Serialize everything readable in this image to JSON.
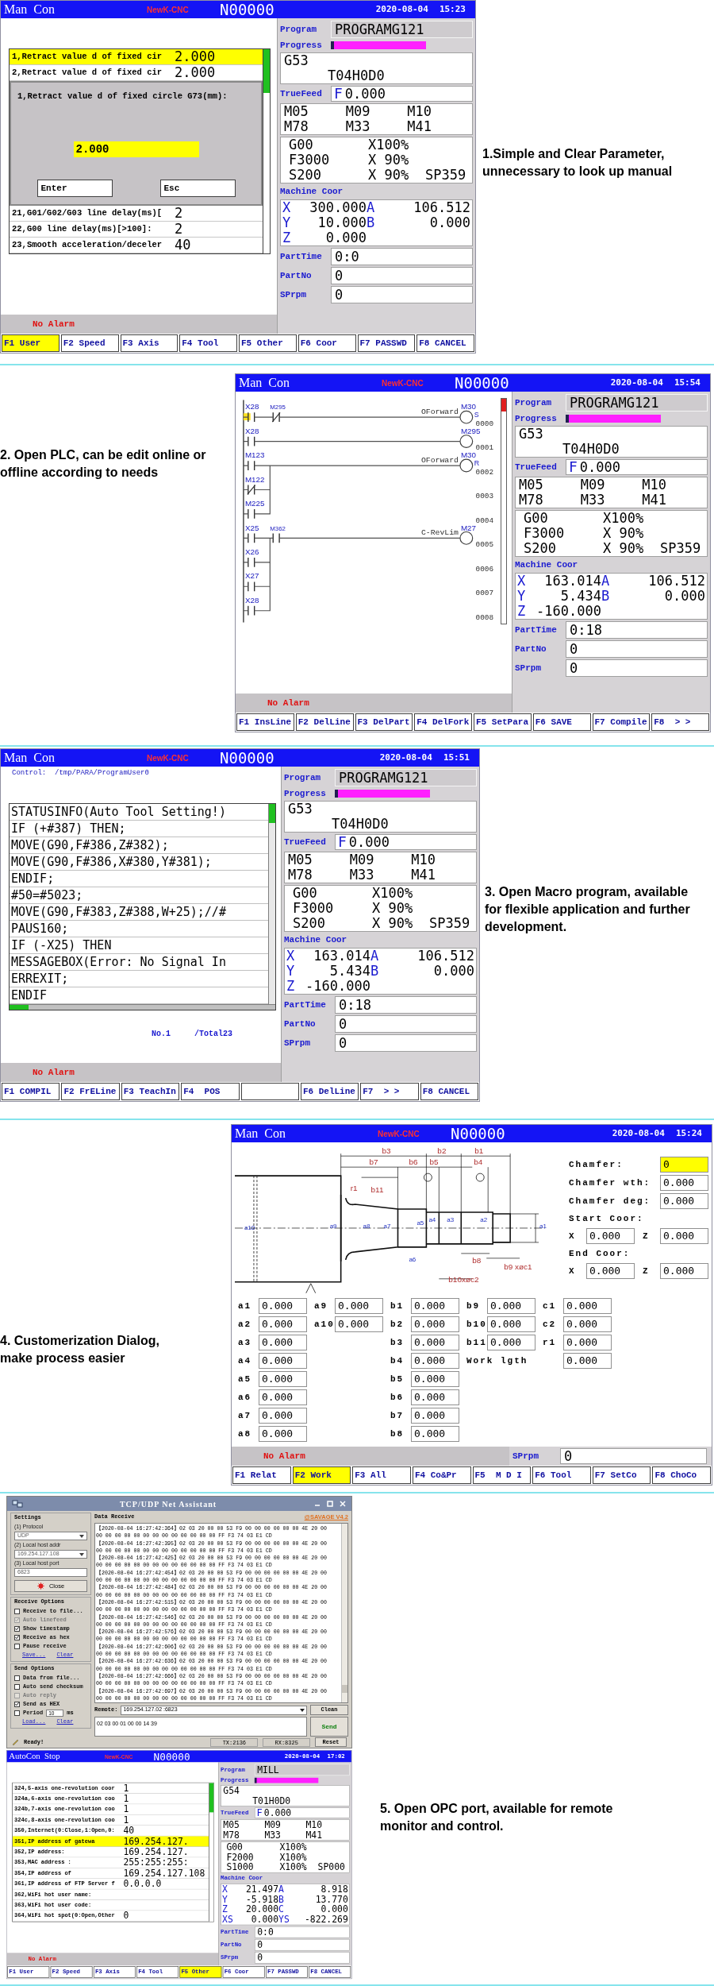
{
  "sections": [
    {
      "kind": "parameters",
      "caption": "1.Simple and Clear Parameter, unnecessary to look up manual",
      "screen": {
        "mode": "Man  Con",
        "brand": "NewK-CNC",
        "block": "N00000",
        "date": "2020-08-04",
        "time": "15:23",
        "content": {
          "kind": "parameters",
          "rows": [
            {
              "label": "1,Retract value d of fixed cir",
              "value": "2.000",
              "selected": true
            },
            {
              "label": "2,Retract value d of fixed cir",
              "value": "2.000",
              "selected": false
            }
          ],
          "dialog": {
            "prompt": "1,Retract value d of fixed circle G73(mm):",
            "value": "2.000",
            "buttons": [
              "Enter",
              "Esc"
            ]
          },
          "rows_after": [
            {
              "label": "21,G01/G02/G03 line delay(ms)[",
              "value": "2",
              "selected": false
            },
            {
              "label": "22,G00 line delay(ms)[>100]:",
              "value": "2",
              "selected": false
            },
            {
              "label": "23,Smooth acceleration/deceler",
              "value": "40",
              "selected": false
            }
          ]
        },
        "alarm": "No Alarm",
        "panel": {
          "program": {
            "label": "Program",
            "value": "PROGRAMG121"
          },
          "progress": {
            "label": "Progress",
            "level": 0.03
          },
          "modal": [
            "G53",
            "T04H0D0"
          ],
          "feed": {
            "label": "TrueFeed",
            "axis": "F",
            "value": "0.000"
          },
          "m_codes": [
            "M05",
            "M09",
            "M10",
            "M78",
            "M33",
            "M41"
          ],
          "overrides": [
            [
              "G00",
              "X100%"
            ],
            [
              "F3000",
              "X 90%"
            ],
            [
              "S200",
              "X 90%",
              "SP359"
            ]
          ],
          "coor": {
            "label": "Machine Coor",
            "rows": [
              [
                {
                  "axis": "X",
                  "value": "300.000"
                },
                {
                  "axis": "A",
                  "value": "106.512"
                }
              ],
              [
                {
                  "axis": "Y",
                  "value": "10.000"
                },
                {
                  "axis": "B",
                  "value": "0.000"
                }
              ],
              [
                {
                  "axis": "Z",
                  "value": "0.000"
                }
              ]
            ]
          },
          "stats": [
            {
              "label": "PartTime",
              "value": "0:0"
            },
            {
              "label": "PartNo",
              "value": "0"
            },
            {
              "label": "SPrpm",
              "value": "0"
            }
          ]
        },
        "keys": [
          {
            "label": "F1 User",
            "selected": true
          },
          {
            "label": "F2 Speed",
            "selected": false
          },
          {
            "label": "F3 Axis",
            "selected": false
          },
          {
            "label": "F4 Tool",
            "selected": false
          },
          {
            "label": "F5 Other",
            "selected": false
          },
          {
            "label": "F6 Coor",
            "selected": false
          },
          {
            "label": "F7 PASSWD",
            "selected": false
          },
          {
            "label": "F8 CANCEL",
            "selected": false
          }
        ]
      }
    },
    {
      "kind": "plc",
      "caption": "2. Open PLC, can be edit online or offline according to needs",
      "screen": {
        "mode": "Man  Con",
        "brand": "NewK-CNC",
        "block": "N00000",
        "date": "2020-08-04",
        "time": "15:54",
        "content": {
          "kind": "ladder",
          "rungs": [
            {
              "number": "0000",
              "contacts": [
                {
                  "label": "X28",
                  "kind": "open",
                  "active": true
                },
                {
                  "label": "M295",
                  "kind": "closed",
                  "active": false
                }
              ],
              "coil": {
                "label": "M30",
                "comment": "OForward",
                "flag": "S"
              }
            },
            {
              "number": "0001",
              "contacts": [
                {
                  "label": "X28",
                  "kind": "open",
                  "active": false
                }
              ],
              "coil": {
                "label": "M295"
              }
            },
            {
              "number": "0002",
              "contacts": [
                {
                  "label": "M123",
                  "kind": "open",
                  "active": false
                }
              ],
              "coil": {
                "label": "M30",
                "comment": "OForward",
                "flag": "R"
              }
            },
            {
              "number": "0003",
              "branch": true,
              "contacts": [
                {
                  "label": "M122",
                  "kind": "closed",
                  "active": false
                }
              ]
            },
            {
              "number": "0004",
              "branch": true,
              "contacts": [
                {
                  "label": "M225",
                  "kind": "open",
                  "active": false
                }
              ]
            },
            {
              "number": "0005",
              "contacts": [
                {
                  "label": "X25",
                  "kind": "open",
                  "active": false
                },
                {
                  "label": "M362",
                  "kind": "open",
                  "active": false
                }
              ],
              "coil": {
                "label": "M27",
                "comment": "C-RevLim"
              }
            },
            {
              "number": "0006",
              "branch": true,
              "contacts": [
                {
                  "label": "X26",
                  "kind": "open",
                  "active": false
                }
              ]
            },
            {
              "number": "0007",
              "branch": true,
              "contacts": [
                {
                  "label": "X27",
                  "kind": "open",
                  "active": false
                }
              ]
            },
            {
              "number": "0008",
              "branch": true,
              "contacts": [
                {
                  "label": "X28",
                  "kind": "open",
                  "active": false
                }
              ]
            }
          ]
        },
        "alarm": "No Alarm",
        "panel": {
          "program": {
            "label": "Program",
            "value": "PROGRAMG121"
          },
          "progress": {
            "label": "Progress",
            "level": 0.03
          },
          "modal": [
            "G53",
            "T04H0D0"
          ],
          "feed": {
            "label": "TrueFeed",
            "axis": "F",
            "value": "0.000"
          },
          "m_codes": [
            "M05",
            "M09",
            "M10",
            "M78",
            "M33",
            "M41"
          ],
          "overrides": [
            [
              "G00",
              "X100%"
            ],
            [
              "F3000",
              "X 90%"
            ],
            [
              "S200",
              "X 90%",
              "SP359"
            ]
          ],
          "coor": {
            "label": "Machine Coor",
            "rows": [
              [
                {
                  "axis": "X",
                  "value": "163.014"
                },
                {
                  "axis": "A",
                  "value": "106.512"
                }
              ],
              [
                {
                  "axis": "Y",
                  "value": "5.434"
                },
                {
                  "axis": "B",
                  "value": "0.000"
                }
              ],
              [
                {
                  "axis": "Z",
                  "value": "-160.000"
                }
              ]
            ]
          },
          "stats": [
            {
              "label": "PartTime",
              "value": "0:18"
            },
            {
              "label": "PartNo",
              "value": "0"
            },
            {
              "label": "SPrpm",
              "value": "0"
            }
          ]
        },
        "keys": [
          {
            "label": "F1 InsLine",
            "selected": false
          },
          {
            "label": "F2 DelLine",
            "selected": false
          },
          {
            "label": "F3 DelPart",
            "selected": false
          },
          {
            "label": "F4 DelFork",
            "selected": false
          },
          {
            "label": "F5 SetPara",
            "selected": false
          },
          {
            "label": "F6 SAVE",
            "selected": false
          },
          {
            "label": "F7 Compile",
            "selected": false
          },
          {
            "label": "F8  > >",
            "selected": false
          }
        ]
      }
    },
    {
      "kind": "macro",
      "caption": "3. Open Macro program, available for flexible application and further development.",
      "screen": {
        "mode": "Man  Con",
        "brand": "NewK-CNC",
        "block": "N00000",
        "date": "2020-08-04",
        "time": "15:51",
        "content": {
          "kind": "macro",
          "path": "Control:  /tmp/PARA/ProgramUser0",
          "lines": [
            "STATUSINFO(Auto Tool Setting!)",
            "IF (+#387) THEN;",
            "MOVE(G90,F#386,Z#382);",
            "MOVE(G90,F#386,X#380,Y#381);",
            "ENDIF;",
            "#50=#5023;",
            "MOVE(G90,F#383,Z#388,W+25);//#",
            "PAUS160;",
            "IF (-X25) THEN",
            "MESSAGEBOX(Error: No Signal In",
            "ERREXIT;",
            "ENDIF"
          ],
          "line_no": "No.1",
          "total": "/Total23"
        },
        "alarm": "No Alarm",
        "panel": {
          "program": {
            "label": "Program",
            "value": "PROGRAMG121"
          },
          "progress": {
            "label": "Progress",
            "level": 0.03
          },
          "modal": [
            "G53",
            "T04H0D0"
          ],
          "feed": {
            "label": "TrueFeed",
            "axis": "F",
            "value": "0.000"
          },
          "m_codes": [
            "M05",
            "M09",
            "M10",
            "M78",
            "M33",
            "M41"
          ],
          "overrides": [
            [
              "G00",
              "X100%"
            ],
            [
              "F3000",
              "X 90%"
            ],
            [
              "S200",
              "X 90%",
              "SP359"
            ]
          ],
          "coor": {
            "label": "Machine Coor",
            "rows": [
              [
                {
                  "axis": "X",
                  "value": "163.014"
                },
                {
                  "axis": "A",
                  "value": "106.512"
                }
              ],
              [
                {
                  "axis": "Y",
                  "value": "5.434"
                },
                {
                  "axis": "B",
                  "value": "0.000"
                }
              ],
              [
                {
                  "axis": "Z",
                  "value": "-160.000"
                }
              ]
            ]
          },
          "stats": [
            {
              "label": "PartTime",
              "value": "0:18"
            },
            {
              "label": "PartNo",
              "value": "0"
            },
            {
              "label": "SPrpm",
              "value": "0"
            }
          ]
        },
        "keys": [
          {
            "label": "F1 COMPIL",
            "selected": false
          },
          {
            "label": "F2 FrELine",
            "selected": false
          },
          {
            "label": "F3 TeachIn",
            "selected": false
          },
          {
            "label": "F4  POS",
            "selected": false
          },
          {
            "selected": false
          },
          {
            "label": "F6 DelLine",
            "selected": false
          },
          {
            "label": "F7  > >",
            "selected": false
          },
          {
            "label": "F8 CANCEL",
            "selected": false
          }
        ]
      }
    },
    {
      "kind": "dialog",
      "caption": "4. Customerization Dialog, make process easier",
      "screen": {
        "mode": "Man  Con",
        "brand": "NewK-CNC",
        "block": "N00000",
        "date": "2020-08-04",
        "time": "15:24",
        "content": {
          "kind": "shaft_dialog",
          "dimension_labels": [
            "b3",
            "b2",
            "b1",
            "b7",
            "b6",
            "b5",
            "b4",
            "r1",
            "b11",
            "b8",
            "b9 xøc1",
            "b10xøc2"
          ],
          "diameter_labels": [
            "a10",
            "a9",
            "a8",
            "a7",
            "a5",
            "a4",
            "a3",
            "a2",
            "a1",
            "a6"
          ],
          "settings": [
            {
              "label": "Chamfer:",
              "value": "0",
              "selected": true
            },
            {
              "label": "Chamfer wth:",
              "value": "0.000",
              "selected": false
            },
            {
              "label": "Chamfer deg:",
              "value": "0.000",
              "selected": false
            }
          ],
          "start": {
            "label": "Start Coor:",
            "coords": [
              {
                "axis": "X",
                "value": "0.000"
              },
              {
                "axis": "Z",
                "value": "0.000"
              }
            ]
          },
          "end": {
            "label": "End Coor:",
            "coords": [
              {
                "axis": "X",
                "value": "0.000"
              },
              {
                "axis": "Z",
                "value": "0.000"
              }
            ]
          },
          "columns": [
            [
              {
                "label": "a1",
                "value": "0.000"
              },
              {
                "label": "a2",
                "value": "0.000"
              },
              {
                "label": "a3",
                "value": "0.000"
              },
              {
                "label": "a4",
                "value": "0.000"
              },
              {
                "label": "a5",
                "value": "0.000"
              },
              {
                "label": "a6",
                "value": "0.000"
              },
              {
                "label": "a7",
                "value": "0.000"
              },
              {
                "label": "a8",
                "value": "0.000"
              }
            ],
            [
              {
                "label": "a9",
                "value": "0.000"
              },
              {
                "label": "a10",
                "value": "0.000"
              }
            ],
            [
              {
                "label": "b1",
                "value": "0.000"
              },
              {
                "label": "b2",
                "value": "0.000"
              },
              {
                "label": "b3",
                "value": "0.000"
              },
              {
                "label": "b4",
                "value": "0.000"
              },
              {
                "label": "b5",
                "value": "0.000"
              },
              {
                "label": "b6",
                "value": "0.000"
              },
              {
                "label": "b7",
                "value": "0.000"
              },
              {
                "label": "b8",
                "value": "0.000"
              }
            ],
            [
              {
                "label": "b9",
                "value": "0.000"
              },
              {
                "label": "b10",
                "value": "0.000"
              },
              {
                "label": "b11",
                "value": "0.000"
              }
            ],
            [
              {
                "label": "c1",
                "value": "0.000"
              },
              {
                "label": "c2",
                "value": "0.000"
              },
              {
                "label": "r1",
                "value": "0.000"
              }
            ]
          ],
          "work_length": {
            "label": "Work lgth",
            "value": "0.000"
          }
        },
        "alarm": "No Alarm",
        "side_stats": [
          {
            "label": "SPrpm",
            "value": "0"
          }
        ],
        "keys": [
          {
            "label": "F1 Relat",
            "selected": false
          },
          {
            "label": "F2 Work",
            "selected": true
          },
          {
            "label": "F3 All",
            "selected": false
          },
          {
            "label": "F4 Co&Pr",
            "selected": false
          },
          {
            "label": "F5  M D I",
            "selected": false
          },
          {
            "label": "F6 Tool",
            "selected": false
          },
          {
            "label": "F7 SetCo",
            "selected": false
          },
          {
            "label": "F8 ChoCo",
            "selected": false
          }
        ]
      }
    },
    {
      "kind": "opc",
      "caption": "5. Open OPC port, available for remote monitor and control.",
      "assistant": {
        "title": "TCP/UDP Net Assistant",
        "settings": {
          "title": "Settings",
          "fields": [
            {
              "label": "(1) Protocol",
              "value": "UDP",
              "kind": "dropdown"
            },
            {
              "label": "(2) Local host addr",
              "value": "169.254.127.108",
              "kind": "dropdown"
            },
            {
              "label": "(3) Local host port",
              "value": "6823",
              "kind": "input"
            }
          ],
          "button": "Close"
        },
        "receive_options": {
          "title": "Receive Options",
          "items": [
            {
              "label": "Receive to file...",
              "checked": false,
              "disabled": false
            },
            {
              "label": "Auto linefeed",
              "checked": true,
              "disabled": true
            },
            {
              "label": "Show timestamp",
              "checked": true,
              "disabled": false
            },
            {
              "label": "Receive as hex",
              "checked": true,
              "disabled": false
            },
            {
              "label": "Pause receive",
              "checked": false,
              "disabled": false
            }
          ],
          "links": [
            "Save...",
            "Clear"
          ]
        },
        "send_options": {
          "title": "Send Options",
          "items": [
            {
              "label": "Data from file...",
              "checked": false,
              "disabled": false
            },
            {
              "label": "Auto send checksum",
              "checked": false,
              "disabled": false
            },
            {
              "label": "Auto reply",
              "checked": false,
              "disabled": true
            },
            {
              "label": "Send as HEX",
              "checked": true,
              "disabled": false
            },
            {
              "label": "Period",
              "checked": false,
              "disabled": false,
              "value": "10",
              "unit": "ms"
            }
          ],
          "links": [
            "Load...",
            "Clear"
          ]
        },
        "receive": {
          "title": "Data Receive",
          "brand": "@SAVAGE V4.2",
          "lines": [
            "【2020-08-04 16:27:42:364】02 03 20 00 00 53 F9 00 00 00 00 00 00 4E 20 00",
            "00 00 00 00 00 00 00 00 00 00 00 00 00 FF F3 74 03 E1 CD",
            "【2020-08-04 16:27:42:395】02 03 20 00 00 53 F9 00 00 00 00 00 00 4E 20 00",
            "00 00 00 00 00 00 00 00 00 00 00 00 00 FF F3 74 03 E1 CD",
            "【2020-08-04 16:27:42:425】02 03 20 00 00 53 F9 00 00 00 00 00 00 4E 20 00",
            "00 00 00 00 00 00 00 00 00 00 00 00 00 FF F3 74 03 E1 CD",
            "【2020-08-04 16:27:42:454】02 03 20 00 00 53 F9 00 00 00 00 00 00 4E 20 00",
            "00 00 00 00 00 00 00 00 00 00 00 00 00 FF F3 74 03 E1 CD",
            "【2020-08-04 16:27:42:484】02 03 20 00 00 53 F9 00 00 00 00 00 00 4E 20 00",
            "00 00 00 00 00 00 00 00 00 00 00 00 00 FF F3 74 03 E1 CD",
            "【2020-08-04 16:27:42:515】02 03 20 00 00 53 F9 00 00 00 00 00 00 4E 20 00",
            "00 00 00 00 00 00 00 00 00 00 00 00 00 FF F3 74 03 E1 CD",
            "【2020-08-04 16:27:42:546】02 03 20 00 00 53 F9 00 00 00 00 00 00 4E 20 00",
            "00 00 00 00 00 00 00 00 00 00 00 00 00 FF F3 74 03 E1 CD",
            "【2020-08-04 16:27:42:576】02 03 20 00 00 53 F9 00 00 00 00 00 00 4E 20 00",
            "00 00 00 00 00 00 00 00 00 00 00 00 00 FF F3 74 03 E1 CD",
            "【2020-08-04 16:27:42:606】02 03 20 00 00 53 F9 00 00 00 00 00 00 4E 20 00",
            "00 00 00 00 00 00 00 00 00 00 00 00 00 FF F3 74 03 E1 CD",
            "【2020-08-04 16:27:42:636】02 03 20 00 00 53 F9 00 00 00 00 00 00 4E 20 00",
            "00 00 00 00 00 00 00 00 00 00 00 00 00 FF F3 74 03 E1 CD",
            "【2020-08-04 16:27:42:666】02 03 20 00 00 53 F9 00 00 00 00 00 00 4E 20 00",
            "00 00 00 00 00 00 00 00 00 00 00 00 00 FF F3 74 03 E1 CD",
            "【2020-08-04 16:27:42:697】02 03 20 00 00 53 F9 00 00 00 00 00 00 4E 20 00",
            "00 00 00 00 00 00 00 00 00 00 00 00 00 FF F3 74 03 E1 CD"
          ]
        },
        "remote": {
          "label": "Remote:",
          "value": "169.254.127.02 :6823",
          "button": "Clean"
        },
        "send": {
          "value": "02 03 00 01 00 00 14 39",
          "button": "Send"
        },
        "status": {
          "text": "Ready!",
          "tx": "TX:2136",
          "rx": "RX:8325",
          "button": "Reset"
        }
      },
      "screen": {
        "mode": "AutoCon  Stop",
        "brand": "NewK-CNC",
        "block": "N00000",
        "date": "2020-08-04",
        "time": "17:02",
        "content": {
          "kind": "parameters",
          "rows": [
            {
              "label": "324,5-axis one-revolution coor",
              "value": "1",
              "selected": false
            },
            {
              "label": "324a,6-axis one-revolution coo",
              "value": "1",
              "selected": false
            },
            {
              "label": "324b,7-axis one-revolution coo",
              "value": "1",
              "selected": false
            },
            {
              "label": "324c,8-axis one-revolution coo",
              "value": "1",
              "selected": false
            },
            {
              "label": "350,Internet(0:Close,1:Open,0:",
              "value": "40",
              "selected": false
            },
            {
              "label": "351,IP address of gatewa",
              "value": "169.254.127.",
              "selected": true
            },
            {
              "label": "352,IP address:",
              "value": "169.254.127.",
              "selected": false
            },
            {
              "label": "353,MAC address :",
              "value": "255:255:255:",
              "selected": false
            },
            {
              "label": "354,IP address of",
              "value": "169.254.127.108",
              "selected": false
            },
            {
              "label": "361,IP address of FTP Server f",
              "value": "0.0.0.0",
              "selected": false
            },
            {
              "label": "362,WiFi hot user name:",
              "selected": false
            },
            {
              "label": "363,WiFi hot user code:",
              "selected": false
            },
            {
              "label": "364,WiFi hot spot(0:Open,Other",
              "value": "0",
              "selected": false
            }
          ]
        },
        "alarm": "No Alarm",
        "panel": {
          "program": {
            "label": "Program",
            "value": "MILL"
          },
          "progress": {
            "label": "Progress",
            "level": 0.03
          },
          "modal": [
            "G54",
            "T01H0D0"
          ],
          "feed": {
            "label": "TrueFeed",
            "axis": "F",
            "value": "0.000"
          },
          "m_codes": [
            "M05",
            "M09",
            "M10",
            "M78",
            "M33",
            "M41"
          ],
          "overrides": [
            [
              "G00",
              "X100%"
            ],
            [
              "F2000",
              "X100%"
            ],
            [
              "S1000",
              "X100%",
              "SP000"
            ]
          ],
          "coor": {
            "label": "Machine Coor",
            "rows": [
              [
                {
                  "axis": "X",
                  "value": "21.497"
                },
                {
                  "axis": "A",
                  "value": "8.918"
                }
              ],
              [
                {
                  "axis": "Y",
                  "value": "-5.918"
                },
                {
                  "axis": "B",
                  "value": "13.770"
                }
              ],
              [
                {
                  "axis": "Z",
                  "value": "20.000"
                },
                {
                  "axis": "C",
                  "value": "0.000"
                }
              ],
              [
                {
                  "axis": "XS",
                  "value": "0.000"
                },
                {
                  "axis": "YS",
                  "value": "-822.269"
                }
              ]
            ]
          },
          "stats": [
            {
              "label": "PartTime",
              "value": "0:0"
            },
            {
              "label": "PartNo",
              "value": "0"
            },
            {
              "label": "SPrpm",
              "value": "0"
            }
          ]
        },
        "keys": [
          {
            "label": "F1 User",
            "selected": false
          },
          {
            "label": "F2 Speed",
            "selected": false
          },
          {
            "label": "F3 Axis",
            "selected": false
          },
          {
            "label": "F4 Tool",
            "selected": false
          },
          {
            "label": "F5 Other",
            "selected": true
          },
          {
            "label": "F6 Coor",
            "selected": false
          },
          {
            "label": "F7 PASSWD",
            "selected": false
          },
          {
            "label": "F8 CANCEL",
            "selected": false
          }
        ]
      }
    }
  ]
}
